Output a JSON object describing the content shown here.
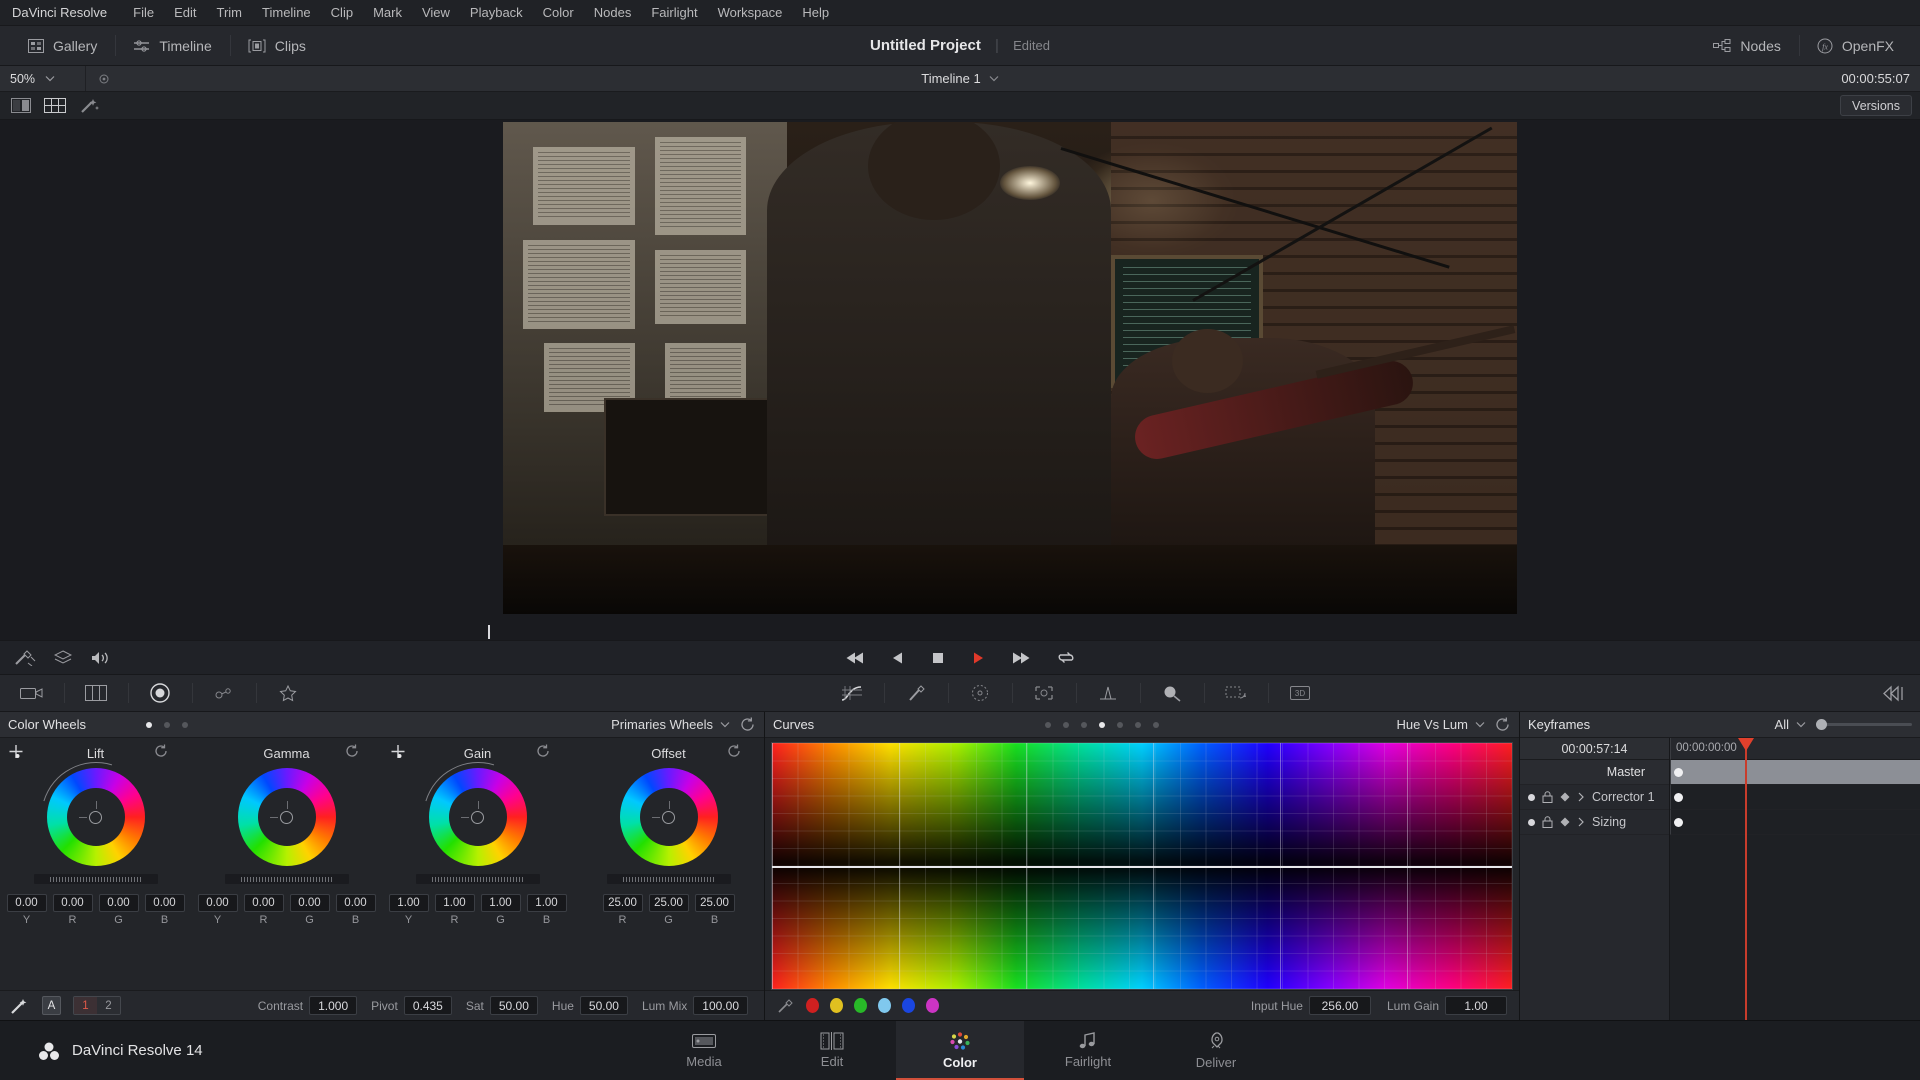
{
  "menubar": {
    "items": [
      {
        "label": "DaVinci Resolve",
        "brand": true
      },
      {
        "label": "File"
      },
      {
        "label": "Edit"
      },
      {
        "label": "Trim"
      },
      {
        "label": "Timeline"
      },
      {
        "label": "Clip"
      },
      {
        "label": "Mark"
      },
      {
        "label": "View"
      },
      {
        "label": "Playback"
      },
      {
        "label": "Color"
      },
      {
        "label": "Nodes"
      },
      {
        "label": "Fairlight"
      },
      {
        "label": "Workspace"
      },
      {
        "label": "Help"
      }
    ]
  },
  "header": {
    "left_buttons": [
      {
        "label": "Gallery",
        "icon": "gallery-icon"
      },
      {
        "label": "Timeline",
        "icon": "timeline-icon"
      },
      {
        "label": "Clips",
        "icon": "clips-icon"
      }
    ],
    "project_title": "Untitled Project",
    "project_status": "Edited",
    "right_buttons": [
      {
        "label": "Nodes",
        "icon": "nodes-icon"
      },
      {
        "label": "OpenFX",
        "icon": "openfx-icon"
      }
    ]
  },
  "subbar": {
    "zoom_level": "50%",
    "timeline_name": "Timeline 1",
    "timecode": "00:00:55:07"
  },
  "viewer_tools": {
    "versions_label": "Versions",
    "icons": [
      "split-screen-icon",
      "grid-view-icon",
      "magic-wand-icon"
    ]
  },
  "transport": {
    "buttons": [
      "jump-to-start-icon",
      "play-reverse-icon",
      "stop-icon",
      "play-icon",
      "jump-to-end-icon",
      "loop-icon"
    ],
    "left_tools": [
      "color-picker-icon",
      "layers-icon",
      "audio-icon"
    ]
  },
  "palette_bar": {
    "left_icons": [
      "camera-icon",
      "gallery-stills-icon",
      "record-icon",
      "tracker-icon",
      "favorite-icon"
    ],
    "center_icons": [
      "curves-palette-icon",
      "qualifier-icon",
      "power-window-icon",
      "tracker-palette-icon",
      "blur-icon",
      "key-icon",
      "sizing-icon",
      "3d-icon"
    ],
    "right_icon": "palette-toggle-icon"
  },
  "color_wheels": {
    "panel_title": "Color Wheels",
    "mode": "Primaries Wheels",
    "page_dots": 3,
    "active_dot": 0,
    "reset_icon": "reset-icon",
    "wheels": [
      {
        "name": "Lift",
        "has_picker": true,
        "labels": [
          "Y",
          "R",
          "G",
          "B"
        ],
        "values": [
          "0.00",
          "0.00",
          "0.00",
          "0.00"
        ]
      },
      {
        "name": "Gamma",
        "has_picker": false,
        "labels": [
          "Y",
          "R",
          "G",
          "B"
        ],
        "values": [
          "0.00",
          "0.00",
          "0.00",
          "0.00"
        ]
      },
      {
        "name": "Gain",
        "has_picker": true,
        "labels": [
          "Y",
          "R",
          "G",
          "B"
        ],
        "values": [
          "1.00",
          "1.00",
          "1.00",
          "1.00"
        ]
      },
      {
        "name": "Offset",
        "has_picker": false,
        "labels": [
          "R",
          "G",
          "B"
        ],
        "values": [
          "25.00",
          "25.00",
          "25.00"
        ]
      }
    ],
    "footer": {
      "node_badge": "A",
      "versions": [
        "1",
        "2"
      ],
      "active_version": "1",
      "fields": [
        {
          "label": "Contrast",
          "value": "1.000"
        },
        {
          "label": "Pivot",
          "value": "0.435"
        },
        {
          "label": "Sat",
          "value": "50.00"
        },
        {
          "label": "Hue",
          "value": "50.00"
        },
        {
          "label": "Lum Mix",
          "value": "100.00"
        }
      ]
    }
  },
  "curves": {
    "panel_title": "Curves",
    "mode": "Hue Vs Lum",
    "page_dots": 7,
    "active_dot": 3,
    "reset_icon": "reset-icon",
    "swatches": [
      "#cf2020",
      "#e0c020",
      "#28b828",
      "#80c8ee",
      "#1a46e0",
      "#cc34c4"
    ],
    "eyedropper_icon": "eyedropper-icon",
    "fields": [
      {
        "label": "Input Hue",
        "value": "256.00"
      },
      {
        "label": "Lum Gain",
        "value": "1.00"
      }
    ]
  },
  "chart_data": {
    "type": "line",
    "title": "Hue Vs Lum",
    "xlabel": "Input Hue",
    "ylabel": "Luminance Gain",
    "x": [
      0,
      60,
      120,
      180,
      240,
      300,
      360
    ],
    "values": [
      1.0,
      1.0,
      1.0,
      1.0,
      1.0,
      1.0,
      1.0
    ],
    "ylim": [
      0,
      2
    ],
    "xlim": [
      0,
      360
    ],
    "grid": true,
    "legend": "none",
    "annotations": [
      "flat neutral curve at gain 1.00"
    ]
  },
  "keyframes": {
    "panel_title": "Keyframes",
    "filter": "All",
    "timecode": "00:00:57:14",
    "ruler_start": "00:00:00:00",
    "rows": [
      {
        "label": "Master",
        "type": "master"
      },
      {
        "label": "Corrector 1",
        "type": "track"
      },
      {
        "label": "Sizing",
        "type": "track"
      }
    ]
  },
  "bottom_nav": {
    "brand": "DaVinci Resolve 14",
    "pages": [
      {
        "label": "Media",
        "icon": "media-page-icon",
        "active": false
      },
      {
        "label": "Edit",
        "icon": "edit-page-icon",
        "active": false
      },
      {
        "label": "Color",
        "icon": "color-page-icon",
        "active": true
      },
      {
        "label": "Fairlight",
        "icon": "fairlight-page-icon",
        "active": false
      },
      {
        "label": "Deliver",
        "icon": "deliver-page-icon",
        "active": false
      }
    ]
  },
  "colors": {
    "accent": "#d2503a",
    "panel_bg": "#232529",
    "header_bg": "#26282d",
    "app_bg": "#1d1f23"
  }
}
